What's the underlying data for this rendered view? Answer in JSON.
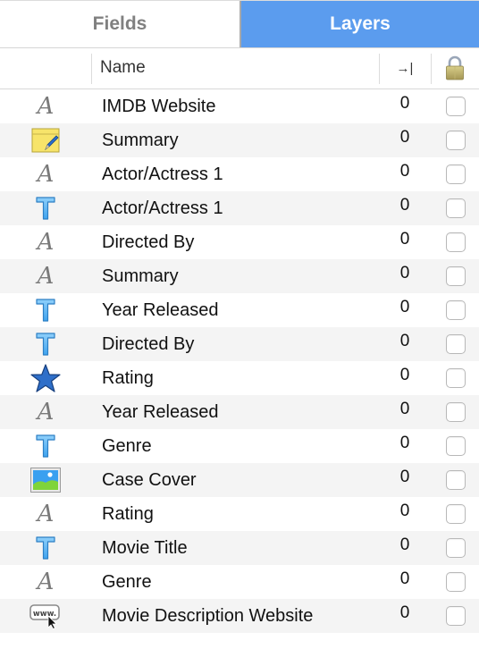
{
  "tabs": [
    {
      "label": "Fields",
      "selected": false
    },
    {
      "label": "Layers",
      "selected": true
    }
  ],
  "columns": {
    "name": "Name",
    "tab_order_icon": "tab-order-icon",
    "tab_order_glyph": "→|",
    "lock_icon": "lock-icon"
  },
  "colors": {
    "accent": "#5b9cee",
    "stripe": "#f4f4f4"
  },
  "rows": [
    {
      "icon": "text-label-icon",
      "name": "IMDB Website",
      "order": "0",
      "locked": false
    },
    {
      "icon": "note-icon",
      "name": "Summary",
      "order": "0",
      "locked": false
    },
    {
      "icon": "text-label-icon",
      "name": "Actor/Actress 1",
      "order": "0",
      "locked": false
    },
    {
      "icon": "text-field-icon",
      "name": "Actor/Actress 1",
      "order": "0",
      "locked": false
    },
    {
      "icon": "text-label-icon",
      "name": "Directed By",
      "order": "0",
      "locked": false
    },
    {
      "icon": "text-label-icon",
      "name": "Summary",
      "order": "0",
      "locked": false
    },
    {
      "icon": "text-field-icon",
      "name": "Year Released",
      "order": "0",
      "locked": false
    },
    {
      "icon": "text-field-icon",
      "name": "Directed By",
      "order": "0",
      "locked": false
    },
    {
      "icon": "star-icon",
      "name": "Rating",
      "order": "0",
      "locked": false
    },
    {
      "icon": "text-label-icon",
      "name": "Year Released",
      "order": "0",
      "locked": false
    },
    {
      "icon": "text-field-icon",
      "name": "Genre",
      "order": "0",
      "locked": false
    },
    {
      "icon": "image-icon",
      "name": "Case Cover",
      "order": "0",
      "locked": false
    },
    {
      "icon": "text-label-icon",
      "name": "Rating",
      "order": "0",
      "locked": false
    },
    {
      "icon": "text-field-icon",
      "name": "Movie Title",
      "order": "0",
      "locked": false
    },
    {
      "icon": "text-label-icon",
      "name": "Genre",
      "order": "0",
      "locked": false
    },
    {
      "icon": "web-link-icon",
      "name": "Movie Description Website",
      "order": "0",
      "locked": false
    }
  ]
}
